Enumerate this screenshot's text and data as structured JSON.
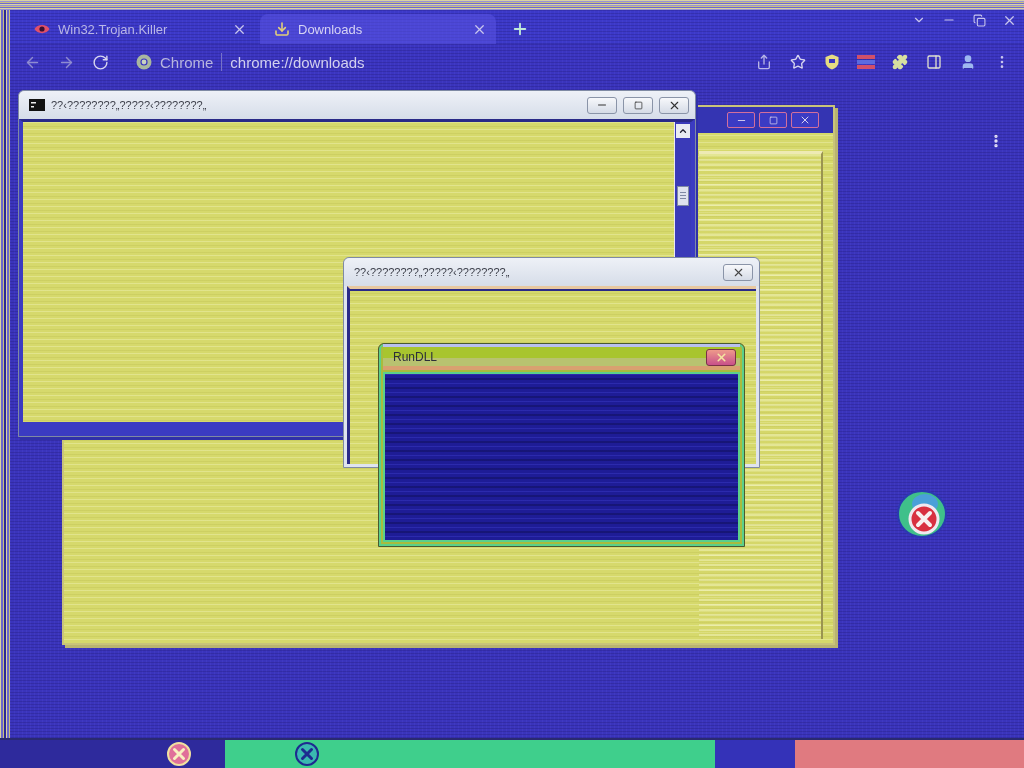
{
  "browser": {
    "tabs": [
      {
        "title": "Win32.Trojan.Killer",
        "selected": false
      },
      {
        "title": "Downloads",
        "selected": true
      }
    ],
    "omnibox": {
      "site_chip": "Chrome",
      "url": "chrome://downloads"
    }
  },
  "windows": [
    {
      "kind": "blank"
    },
    {
      "kind": "console",
      "title": "??‹????????„?????‹????????„"
    },
    {
      "kind": "dialog",
      "title": "??‹????????„?????‹????????„"
    },
    {
      "kind": "message",
      "title": "RunDLL"
    }
  ]
}
